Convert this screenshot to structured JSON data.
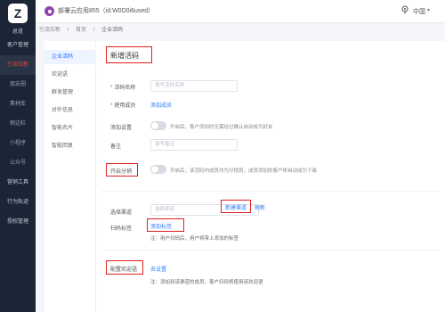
{
  "app": {
    "logo_letter": "Z",
    "org_name": "部署云应用855（id:W0D0i6used）",
    "language": "中国",
    "language_caret": "▾"
  },
  "sidebar": {
    "home": "总览",
    "items": [
      {
        "label": "客户管理"
      },
      {
        "label": "引流拉新"
      },
      {
        "label": "朋友圈"
      },
      {
        "label": "素材库"
      },
      {
        "label": "侧边栏"
      },
      {
        "label": "小程序"
      },
      {
        "label": "公众号"
      },
      {
        "label": "营销工具"
      },
      {
        "label": "行为轨迹"
      },
      {
        "label": "授权管理"
      }
    ]
  },
  "breadcrumb": {
    "items": [
      "引流拉新",
      "/",
      "首页",
      "/",
      "企业活码"
    ]
  },
  "subnav": {
    "items": [
      "企业活码",
      "欢迎语",
      "群发管理",
      "对外信息",
      "智能名片",
      "智能回复"
    ]
  },
  "form": {
    "title": "新增活码",
    "name": {
      "label": "活码名称",
      "placeholder": "填写活码名称"
    },
    "members": {
      "label": "使用成员",
      "link": "添加成员"
    },
    "add_setting": {
      "label": "添加设置",
      "hint": "开启后，客户添加时无需经过确认自动成为好友"
    },
    "remark": {
      "label": "备注",
      "placeholder": "填写备注"
    },
    "split": {
      "label": "开启分销",
      "hint": "开启后，该活码内成员均为分销员，成员添加的客户将自动成为下级"
    },
    "channel": {
      "label": "选择渠道",
      "placeholder": "选择渠道",
      "new_button": "新建渠道",
      "refresh": "刷新"
    },
    "tag": {
      "label": "扫码标签",
      "link": "添加标签",
      "note": "注：用户扫码后，用户将带上添加的标签"
    },
    "welcome": {
      "label": "配置欢迎语",
      "link": "去设置",
      "note": "注：添加到该渠道的成员，客户扫码将使用该欢迎语"
    }
  },
  "colors": {
    "accent": "#2d7bff",
    "highlight": "#e02020",
    "sidebar_bg": "#1c2536"
  }
}
